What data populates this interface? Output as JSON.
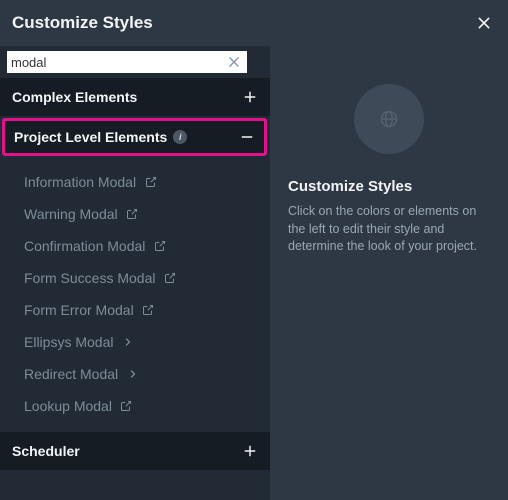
{
  "header": {
    "title": "Customize Styles"
  },
  "search": {
    "value": "modal"
  },
  "sections": {
    "complex": {
      "title": "Complex Elements"
    },
    "project": {
      "title": "Project Level Elements"
    },
    "scheduler": {
      "title": "Scheduler"
    }
  },
  "items": [
    {
      "label": "Information Modal",
      "icon": "external"
    },
    {
      "label": "Warning Modal",
      "icon": "external"
    },
    {
      "label": "Confirmation Modal",
      "icon": "external"
    },
    {
      "label": "Form Success Modal",
      "icon": "external"
    },
    {
      "label": "Form Error Modal",
      "icon": "external"
    },
    {
      "label": "Ellipsys Modal",
      "icon": "chevron"
    },
    {
      "label": "Redirect Modal",
      "icon": "chevron"
    },
    {
      "label": "Lookup Modal",
      "icon": "external"
    }
  ],
  "preview": {
    "title": "Customize Styles",
    "text": "Click on the colors or elements on the left to edit their style and determine the look of your project."
  }
}
